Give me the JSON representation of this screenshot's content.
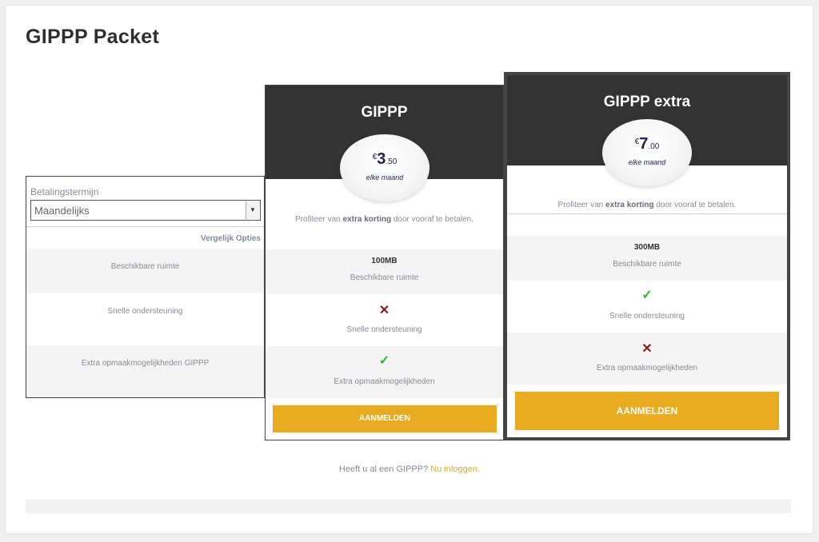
{
  "page": {
    "title": "GIPPP Packet"
  },
  "compare": {
    "term_label": "Betalingstermijn",
    "term_value": "Maandelijks",
    "compare_link": "Vergelijk Opties",
    "rows": [
      "Beschikbare ruimte",
      "Snelle ondersteuning",
      "Extra opmaakmogelijkheden GIPPP"
    ]
  },
  "plans": [
    {
      "name": "GIPPP",
      "currency": "€",
      "price_main": "3",
      "price_dec": ".50",
      "period": "elke maand",
      "promo_pre": "Profiteer van ",
      "promo_bold": "extra korting",
      "promo_post": " door vooraf te betalen.",
      "storage_value": "100MB",
      "storage_label": "Beschikbare ruimte",
      "support_label": "Snelle ondersteuning",
      "extra_label": "Extra opmaakmogelijkheden",
      "button_label": "AANMELDEN"
    },
    {
      "name": "GIPPP extra",
      "currency": "€",
      "price_main": "7",
      "price_dec": ".00",
      "period": "elke maand",
      "promo_pre": "Profiteer van ",
      "promo_bold": "extra korting",
      "promo_post": " door vooraf te betalen.",
      "storage_value": "300MB",
      "storage_label": "Beschikbare ruimte",
      "support_label": "Snelle ondersteuning",
      "extra_label": "Extra opmaakmogelijkheden",
      "button_label": "AANMELDEN"
    }
  ],
  "footer": {
    "text": "Heeft u al een GIPPP? ",
    "link": "Nu inloggen."
  },
  "icons": {
    "cross": "✕",
    "check": "✓",
    "chevron": "▼"
  },
  "colors": {
    "accent": "#e9ab1f",
    "header": "#333333",
    "check": "#2fb331",
    "cross": "#8b1a1a",
    "price": "#1f2154"
  }
}
